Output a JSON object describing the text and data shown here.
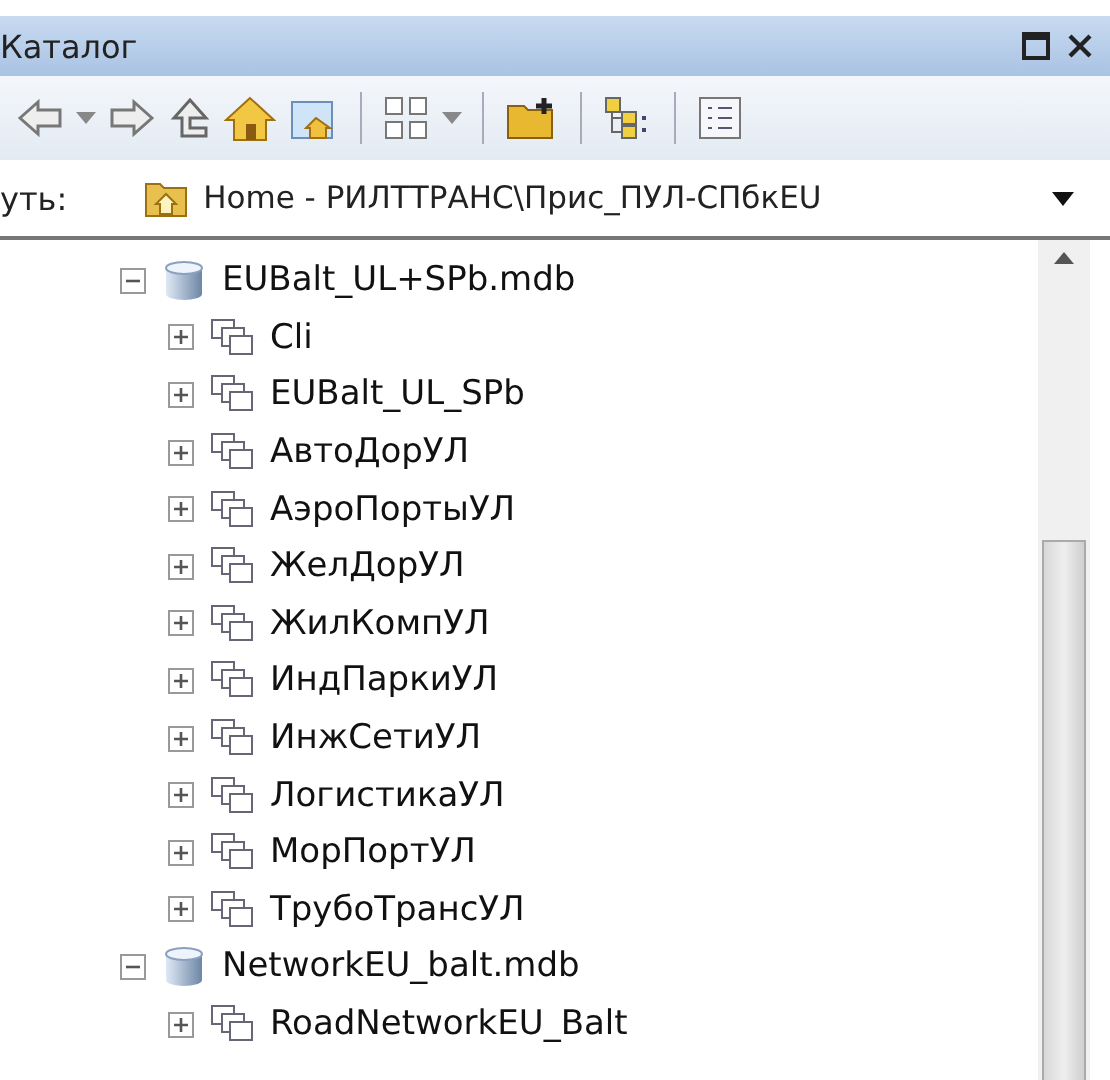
{
  "window": {
    "title": "Каталог",
    "buttons": [
      {
        "kind": "maximize"
      },
      {
        "kind": "close"
      }
    ]
  },
  "toolbar": [
    {
      "kind": "back"
    },
    {
      "kind": "dropdown"
    },
    {
      "kind": "forward"
    },
    {
      "kind": "up"
    },
    {
      "kind": "home"
    },
    {
      "kind": "toggle"
    },
    {
      "kind": "separator"
    },
    {
      "kind": "grid"
    },
    {
      "kind": "dropdown"
    },
    {
      "kind": "separator"
    },
    {
      "kind": "connect"
    },
    {
      "kind": "separator"
    },
    {
      "kind": "tree"
    },
    {
      "kind": "separator"
    },
    {
      "kind": "list"
    }
  ],
  "path": {
    "label": "уть:",
    "value": "Home - РИЛТТРАНС\\Прис_ПУЛ-СПбкEU"
  },
  "tree": [
    {
      "label": "EUBalt_UL+SPb.mdb",
      "kind": "database",
      "expanded": true,
      "children": [
        {
          "label": "Cli",
          "kind": "dataset",
          "expanded": false
        },
        {
          "label": "EUBalt_UL_SPb",
          "kind": "dataset",
          "expanded": false
        },
        {
          "label": "АвтоДорУЛ",
          "kind": "dataset",
          "expanded": false
        },
        {
          "label": "АэроПортыУЛ",
          "kind": "dataset",
          "expanded": false
        },
        {
          "label": "ЖелДорУЛ",
          "kind": "dataset",
          "expanded": false
        },
        {
          "label": "ЖилКомпУЛ",
          "kind": "dataset",
          "expanded": false
        },
        {
          "label": "ИндПаркиУЛ",
          "kind": "dataset",
          "expanded": false
        },
        {
          "label": "ИнжСетиУЛ",
          "kind": "dataset",
          "expanded": false
        },
        {
          "label": "ЛогистикаУЛ",
          "kind": "dataset",
          "expanded": false
        },
        {
          "label": "МорПортУЛ",
          "kind": "dataset",
          "expanded": false
        },
        {
          "label": "ТрубоТрансУЛ",
          "kind": "dataset",
          "expanded": false
        }
      ]
    },
    {
      "label": "NetworkEU_balt.mdb",
      "kind": "database",
      "expanded": true,
      "children": [
        {
          "label": "RoadNetworkEU_Balt",
          "kind": "dataset",
          "expanded": false
        }
      ]
    }
  ]
}
